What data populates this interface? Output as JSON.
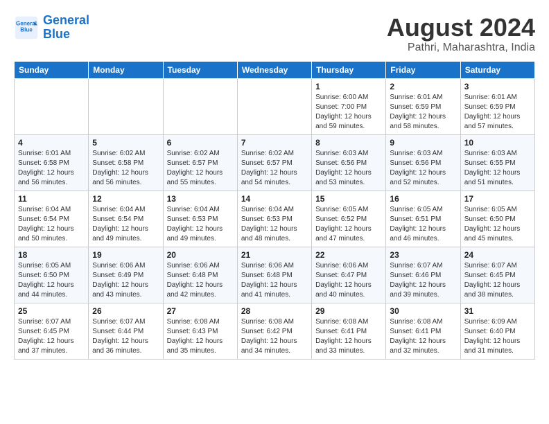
{
  "header": {
    "logo_line1": "General",
    "logo_line2": "Blue",
    "month_year": "August 2024",
    "location": "Pathri, Maharashtra, India"
  },
  "weekdays": [
    "Sunday",
    "Monday",
    "Tuesday",
    "Wednesday",
    "Thursday",
    "Friday",
    "Saturday"
  ],
  "weeks": [
    [
      {
        "day": "",
        "info": ""
      },
      {
        "day": "",
        "info": ""
      },
      {
        "day": "",
        "info": ""
      },
      {
        "day": "",
        "info": ""
      },
      {
        "day": "1",
        "info": "Sunrise: 6:00 AM\nSunset: 7:00 PM\nDaylight: 12 hours\nand 59 minutes."
      },
      {
        "day": "2",
        "info": "Sunrise: 6:01 AM\nSunset: 6:59 PM\nDaylight: 12 hours\nand 58 minutes."
      },
      {
        "day": "3",
        "info": "Sunrise: 6:01 AM\nSunset: 6:59 PM\nDaylight: 12 hours\nand 57 minutes."
      }
    ],
    [
      {
        "day": "4",
        "info": "Sunrise: 6:01 AM\nSunset: 6:58 PM\nDaylight: 12 hours\nand 56 minutes."
      },
      {
        "day": "5",
        "info": "Sunrise: 6:02 AM\nSunset: 6:58 PM\nDaylight: 12 hours\nand 56 minutes."
      },
      {
        "day": "6",
        "info": "Sunrise: 6:02 AM\nSunset: 6:57 PM\nDaylight: 12 hours\nand 55 minutes."
      },
      {
        "day": "7",
        "info": "Sunrise: 6:02 AM\nSunset: 6:57 PM\nDaylight: 12 hours\nand 54 minutes."
      },
      {
        "day": "8",
        "info": "Sunrise: 6:03 AM\nSunset: 6:56 PM\nDaylight: 12 hours\nand 53 minutes."
      },
      {
        "day": "9",
        "info": "Sunrise: 6:03 AM\nSunset: 6:56 PM\nDaylight: 12 hours\nand 52 minutes."
      },
      {
        "day": "10",
        "info": "Sunrise: 6:03 AM\nSunset: 6:55 PM\nDaylight: 12 hours\nand 51 minutes."
      }
    ],
    [
      {
        "day": "11",
        "info": "Sunrise: 6:04 AM\nSunset: 6:54 PM\nDaylight: 12 hours\nand 50 minutes."
      },
      {
        "day": "12",
        "info": "Sunrise: 6:04 AM\nSunset: 6:54 PM\nDaylight: 12 hours\nand 49 minutes."
      },
      {
        "day": "13",
        "info": "Sunrise: 6:04 AM\nSunset: 6:53 PM\nDaylight: 12 hours\nand 49 minutes."
      },
      {
        "day": "14",
        "info": "Sunrise: 6:04 AM\nSunset: 6:53 PM\nDaylight: 12 hours\nand 48 minutes."
      },
      {
        "day": "15",
        "info": "Sunrise: 6:05 AM\nSunset: 6:52 PM\nDaylight: 12 hours\nand 47 minutes."
      },
      {
        "day": "16",
        "info": "Sunrise: 6:05 AM\nSunset: 6:51 PM\nDaylight: 12 hours\nand 46 minutes."
      },
      {
        "day": "17",
        "info": "Sunrise: 6:05 AM\nSunset: 6:50 PM\nDaylight: 12 hours\nand 45 minutes."
      }
    ],
    [
      {
        "day": "18",
        "info": "Sunrise: 6:05 AM\nSunset: 6:50 PM\nDaylight: 12 hours\nand 44 minutes."
      },
      {
        "day": "19",
        "info": "Sunrise: 6:06 AM\nSunset: 6:49 PM\nDaylight: 12 hours\nand 43 minutes."
      },
      {
        "day": "20",
        "info": "Sunrise: 6:06 AM\nSunset: 6:48 PM\nDaylight: 12 hours\nand 42 minutes."
      },
      {
        "day": "21",
        "info": "Sunrise: 6:06 AM\nSunset: 6:48 PM\nDaylight: 12 hours\nand 41 minutes."
      },
      {
        "day": "22",
        "info": "Sunrise: 6:06 AM\nSunset: 6:47 PM\nDaylight: 12 hours\nand 40 minutes."
      },
      {
        "day": "23",
        "info": "Sunrise: 6:07 AM\nSunset: 6:46 PM\nDaylight: 12 hours\nand 39 minutes."
      },
      {
        "day": "24",
        "info": "Sunrise: 6:07 AM\nSunset: 6:45 PM\nDaylight: 12 hours\nand 38 minutes."
      }
    ],
    [
      {
        "day": "25",
        "info": "Sunrise: 6:07 AM\nSunset: 6:45 PM\nDaylight: 12 hours\nand 37 minutes."
      },
      {
        "day": "26",
        "info": "Sunrise: 6:07 AM\nSunset: 6:44 PM\nDaylight: 12 hours\nand 36 minutes."
      },
      {
        "day": "27",
        "info": "Sunrise: 6:08 AM\nSunset: 6:43 PM\nDaylight: 12 hours\nand 35 minutes."
      },
      {
        "day": "28",
        "info": "Sunrise: 6:08 AM\nSunset: 6:42 PM\nDaylight: 12 hours\nand 34 minutes."
      },
      {
        "day": "29",
        "info": "Sunrise: 6:08 AM\nSunset: 6:41 PM\nDaylight: 12 hours\nand 33 minutes."
      },
      {
        "day": "30",
        "info": "Sunrise: 6:08 AM\nSunset: 6:41 PM\nDaylight: 12 hours\nand 32 minutes."
      },
      {
        "day": "31",
        "info": "Sunrise: 6:09 AM\nSunset: 6:40 PM\nDaylight: 12 hours\nand 31 minutes."
      }
    ]
  ]
}
